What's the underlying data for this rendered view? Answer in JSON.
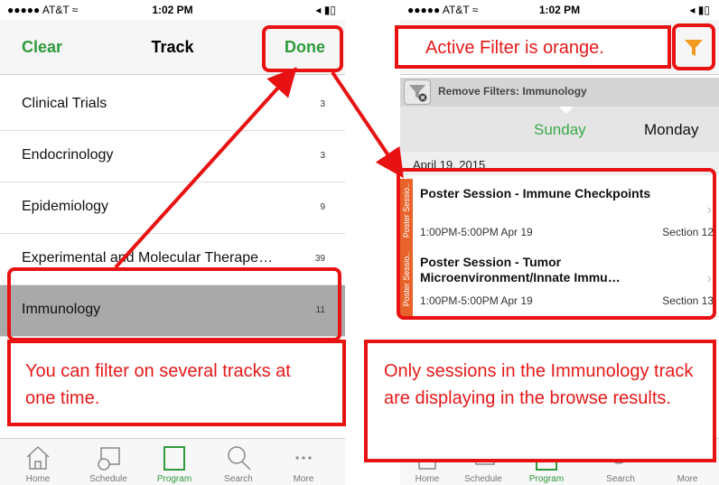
{
  "left": {
    "status": {
      "carrier": "●●●●● AT&T ≈",
      "time": "1:02 PM",
      "battery": "◂ ▮▯"
    },
    "nav": {
      "left": "Clear",
      "title": "Track",
      "right": "Done"
    },
    "tracks": [
      {
        "label": "Clinical Trials",
        "count": "3"
      },
      {
        "label": "Endocrinology",
        "count": "3"
      },
      {
        "label": "Epidemiology",
        "count": "9"
      },
      {
        "label": "Experimental and Molecular Therape…",
        "count": "39"
      },
      {
        "label": "Immunology",
        "count": "11"
      }
    ],
    "callout": "You can filter on several tracks at one time."
  },
  "right": {
    "status": {
      "carrier": "●●●●● AT&T ≈",
      "time": "1:02 PM",
      "battery": "◂ ▮▯"
    },
    "header_callout": "Active Filter is orange.",
    "filter_text": "Remove Filters: Immunology",
    "day_selected": "Sunday",
    "day_next": "Monday",
    "date_header": "April 19, 2015",
    "sessions": [
      {
        "tag": "Poster Sessio..",
        "title": "Poster Session - Immune Checkpoints",
        "time": "1:00PM-5:00PM  Apr 19",
        "room": "Section 12"
      },
      {
        "tag": "Poster Sessio..",
        "title": "Poster Session - Tumor Microenvironment/Innate Immu…",
        "time": "1:00PM-5:00PM  Apr 19",
        "room": "Section 13"
      }
    ],
    "callout": "Only sessions in the Immunology track are displaying in the browse results."
  },
  "tabs": [
    {
      "label": "Home",
      "icon": "home-icon"
    },
    {
      "label": "Schedule",
      "icon": "calendar-clock-icon"
    },
    {
      "label": "Program",
      "icon": "book-icon"
    },
    {
      "label": "Search",
      "icon": "search-icon"
    },
    {
      "label": "More",
      "icon": "more-dots-icon"
    }
  ],
  "colors": {
    "accent_green": "#2e9a3b",
    "annotation_red": "#e81212",
    "filter_orange": "#f29a1f",
    "tag_orange": "#e8632a"
  }
}
